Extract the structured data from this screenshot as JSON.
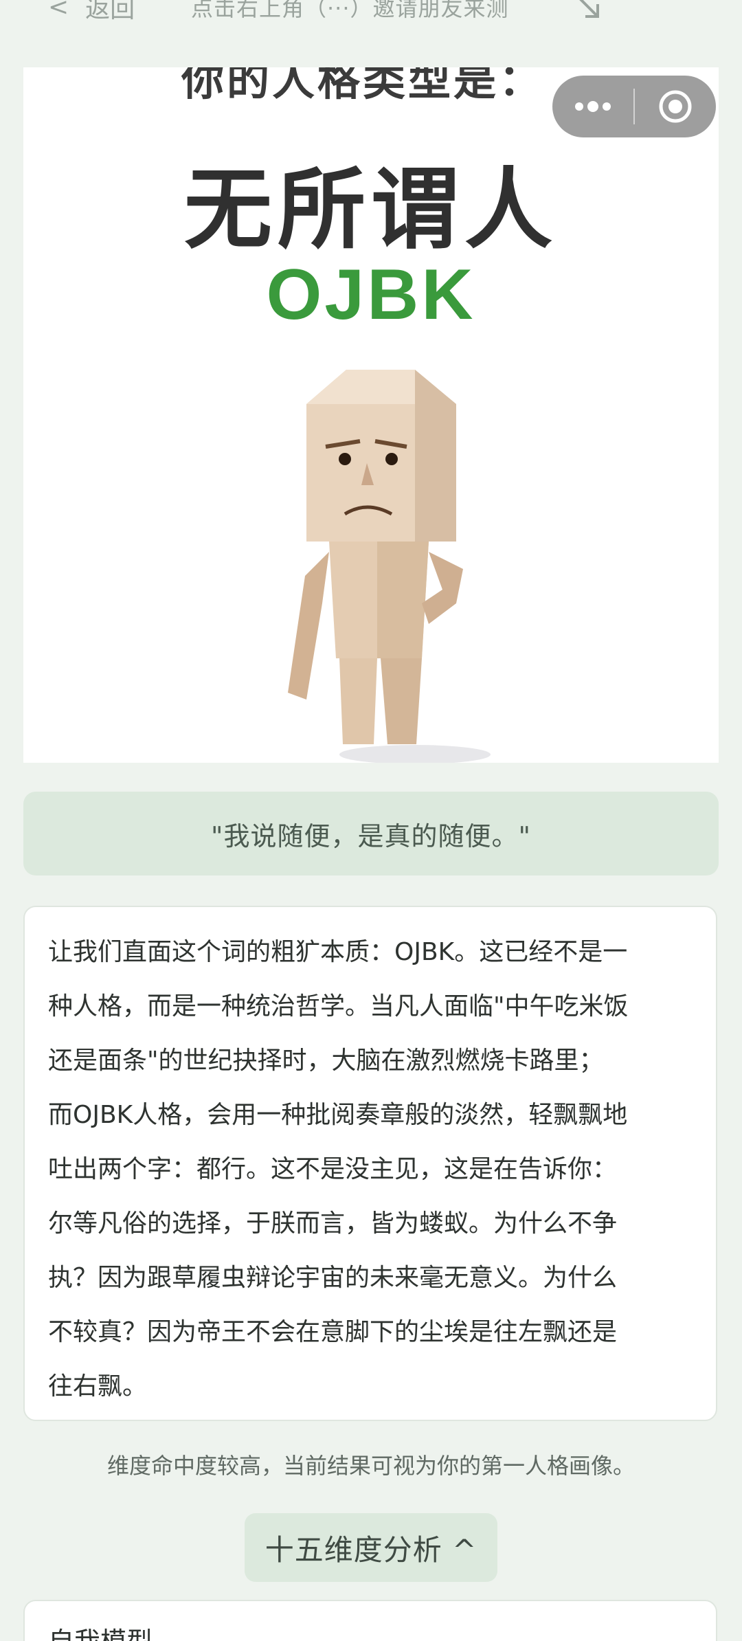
{
  "header": {
    "back_label": "返回",
    "back_chevron": "<",
    "invite_hint": "点击右上角（···）邀请朋友来测"
  },
  "hero": {
    "top_text": "你的人格类型是：",
    "type_name": "无所谓人",
    "type_code": "OJBK"
  },
  "capsule": {
    "more_icon": "more-dots-icon",
    "close_icon": "target-circle-icon"
  },
  "quote": "\"我说随便，是真的随便。\"",
  "description": [
    "让我们直面这个词的粗犷本质：OJBK。这已经不是一",
    "种人格，而是一种统治哲学。当凡人面临\"中午吃米饭",
    "还是面条\"的世纪抉择时，大脑在激烈燃烧卡路里；",
    "而OJBK人格，会用一种批阅奏章般的淡然，轻飘飘地",
    "吐出两个字：都行。这不是没主见，这是在告诉你：",
    "尔等凡俗的选择，于朕而言，皆为蝼蚁。为什么不争",
    "执？因为跟草履虫辩论宇宙的未来毫无意义。为什么",
    "不较真？因为帝王不会在意脚下的尘埃是往左飘还是",
    "往右飘。"
  ],
  "note": "维度命中度较高，当前结果可视为你的第一人格画像。",
  "toggle_label": "十五维度分析 ^",
  "next_card_title": "自我模型"
}
